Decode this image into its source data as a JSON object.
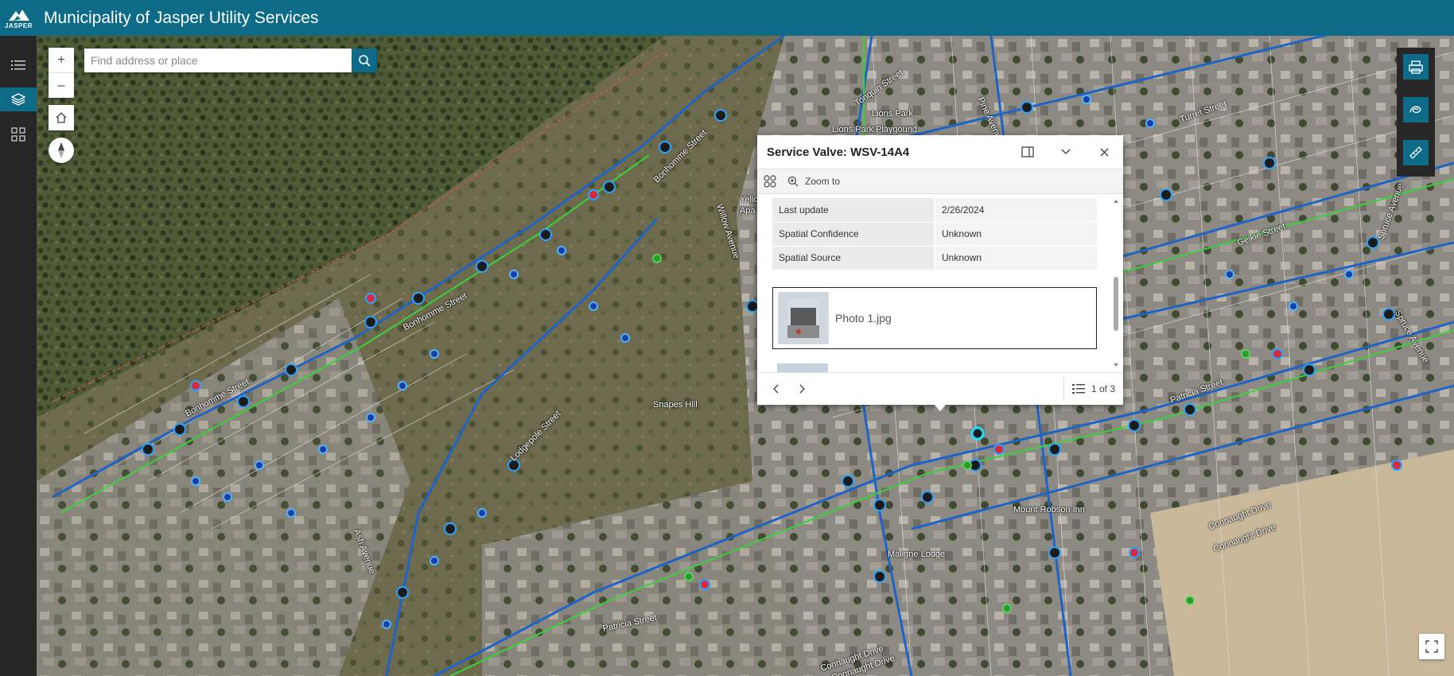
{
  "header": {
    "logo_text": "JASPER",
    "title": "Municipality of Jasper Utility Services"
  },
  "sidebar": {
    "items": [
      {
        "icon": "list-icon"
      },
      {
        "icon": "layers-icon"
      },
      {
        "icon": "grid-icon"
      }
    ]
  },
  "map": {
    "search_placeholder": "Find address or place",
    "place_labels": [
      "Lions Park",
      "Lions Park Playgound",
      "Snapes Hill",
      "Mount Robson Inn",
      "Maligne Lodge",
      "Yello",
      "Apa"
    ],
    "street_labels": [
      "Bonhomme Street",
      "Bonhomme Street",
      "Bonhomme Street",
      "Willow Avenue",
      "Lodgepole Street",
      "Ash Avenue",
      "Patricia Street",
      "Patricia Street",
      "Connaught Drive",
      "Connaught Drive",
      "Connaught Drive",
      "Connaught Drive",
      "Tonquin Street",
      "Pine Avenue",
      "Turret Street",
      "Geikie Street",
      "Spruce Avenue",
      "Spruce Avenue"
    ]
  },
  "popup": {
    "title": "Service Valve: WSV-14A4",
    "zoom_to": "Zoom to",
    "attributes": [
      {
        "key": "Last update",
        "value": "2/26/2024"
      },
      {
        "key": "Spatial Confidence",
        "value": "Unknown"
      },
      {
        "key": "Spatial Source",
        "value": "Unknown"
      }
    ],
    "attachment_name": "Photo 1.jpg",
    "pager": "1 of 3"
  }
}
